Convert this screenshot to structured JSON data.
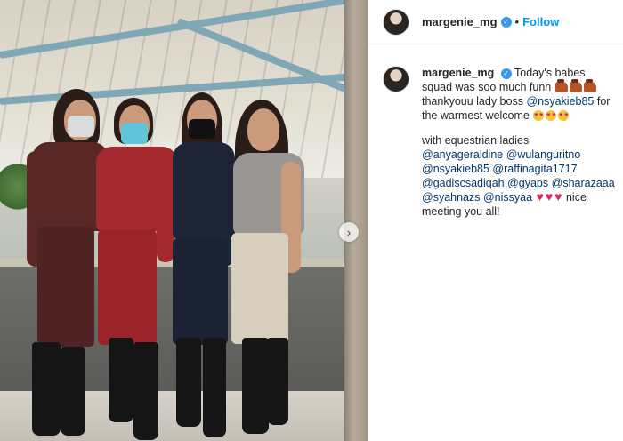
{
  "post": {
    "username": "margenie_mg",
    "verified": true,
    "follow_label": "Follow",
    "separator": "•",
    "carousel_next": "›"
  },
  "caption": {
    "username": "margenie_mg",
    "line1_a": "Today's babes squad was soo much funn",
    "line1_b": "thankyouu lady boss",
    "mention_boss": "@nsyakieb85",
    "line1_c": "for the warmest welcome",
    "line2_intro": "with equestrian ladies",
    "mentions": [
      "@anyageraldine",
      "@wulanguritno",
      "@nsyakieb85",
      "@raffinagita1717",
      "@gadiscsadiqah",
      "@gyaps",
      "@sharazaaa",
      "@syahnazs",
      "@nissyaa"
    ],
    "closing": "nice meeting you all!"
  },
  "colors": {
    "accent": "#0095f6",
    "mention": "#00376b",
    "verified": "#3897f0"
  },
  "icons": [
    "verified-icon",
    "chevron-right-icon",
    "horse-emoji",
    "heart-eyes-emoji",
    "red-heart-emoji"
  ]
}
